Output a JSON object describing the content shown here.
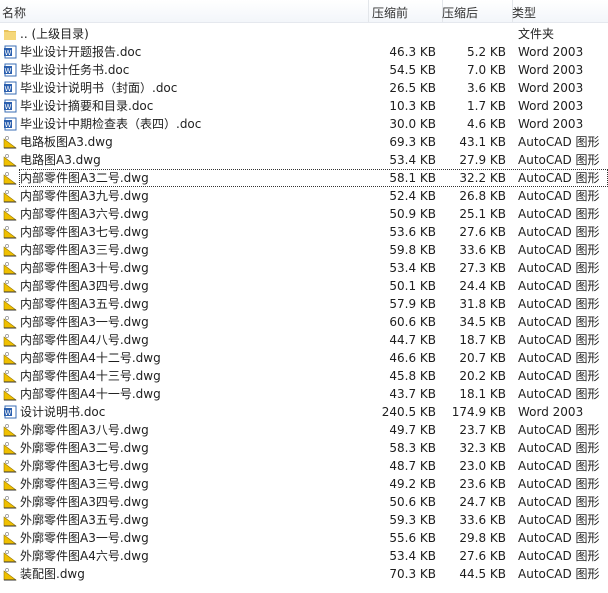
{
  "header": {
    "name": "名称",
    "size_before": "压缩前",
    "size_after": "压缩后",
    "type": "类型"
  },
  "focused_index": 8,
  "rows": [
    {
      "icon": "folder-icon",
      "name": ".. (上级目录)",
      "before": "",
      "after": "",
      "type": "文件夹"
    },
    {
      "icon": "word-icon",
      "name": "毕业设计开题报告.doc",
      "before": "46.3 KB",
      "after": "5.2 KB",
      "type": "Word 2003"
    },
    {
      "icon": "word-icon",
      "name": "毕业设计任务书.doc",
      "before": "54.5 KB",
      "after": "7.0 KB",
      "type": "Word 2003"
    },
    {
      "icon": "word-icon",
      "name": "毕业设计说明书（封面）.doc",
      "before": "26.5 KB",
      "after": "3.6 KB",
      "type": "Word 2003"
    },
    {
      "icon": "word-icon",
      "name": "毕业设计摘要和目录.doc",
      "before": "10.3 KB",
      "after": "1.7 KB",
      "type": "Word 2003"
    },
    {
      "icon": "word-icon",
      "name": "毕业设计中期检查表（表四）.doc",
      "before": "30.0 KB",
      "after": "4.6 KB",
      "type": "Word 2003"
    },
    {
      "icon": "autocad-icon",
      "name": "电路板图A3.dwg",
      "before": "69.3 KB",
      "after": "43.1 KB",
      "type": "AutoCAD 图形"
    },
    {
      "icon": "autocad-icon",
      "name": "电路图A3.dwg",
      "before": "53.4 KB",
      "after": "27.9 KB",
      "type": "AutoCAD 图形"
    },
    {
      "icon": "autocad-icon",
      "name": "内部零件图A3二号.dwg",
      "before": "58.1 KB",
      "after": "32.2 KB",
      "type": "AutoCAD 图形"
    },
    {
      "icon": "autocad-icon",
      "name": "内部零件图A3九号.dwg",
      "before": "52.4 KB",
      "after": "26.8 KB",
      "type": "AutoCAD 图形"
    },
    {
      "icon": "autocad-icon",
      "name": "内部零件图A3六号.dwg",
      "before": "50.9 KB",
      "after": "25.1 KB",
      "type": "AutoCAD 图形"
    },
    {
      "icon": "autocad-icon",
      "name": "内部零件图A3七号.dwg",
      "before": "53.6 KB",
      "after": "27.6 KB",
      "type": "AutoCAD 图形"
    },
    {
      "icon": "autocad-icon",
      "name": "内部零件图A3三号.dwg",
      "before": "59.8 KB",
      "after": "33.6 KB",
      "type": "AutoCAD 图形"
    },
    {
      "icon": "autocad-icon",
      "name": "内部零件图A3十号.dwg",
      "before": "53.4 KB",
      "after": "27.3 KB",
      "type": "AutoCAD 图形"
    },
    {
      "icon": "autocad-icon",
      "name": "内部零件图A3四号.dwg",
      "before": "50.1 KB",
      "after": "24.4 KB",
      "type": "AutoCAD 图形"
    },
    {
      "icon": "autocad-icon",
      "name": "内部零件图A3五号.dwg",
      "before": "57.9 KB",
      "after": "31.8 KB",
      "type": "AutoCAD 图形"
    },
    {
      "icon": "autocad-icon",
      "name": "内部零件图A3一号.dwg",
      "before": "60.6 KB",
      "after": "34.5 KB",
      "type": "AutoCAD 图形"
    },
    {
      "icon": "autocad-icon",
      "name": "内部零件图A4八号.dwg",
      "before": "44.7 KB",
      "after": "18.7 KB",
      "type": "AutoCAD 图形"
    },
    {
      "icon": "autocad-icon",
      "name": "内部零件图A4十二号.dwg",
      "before": "46.6 KB",
      "after": "20.7 KB",
      "type": "AutoCAD 图形"
    },
    {
      "icon": "autocad-icon",
      "name": "内部零件图A4十三号.dwg",
      "before": "45.8 KB",
      "after": "20.2 KB",
      "type": "AutoCAD 图形"
    },
    {
      "icon": "autocad-icon",
      "name": "内部零件图A4十一号.dwg",
      "before": "43.7 KB",
      "after": "18.1 KB",
      "type": "AutoCAD 图形"
    },
    {
      "icon": "word-icon",
      "name": "设计说明书.doc",
      "before": "240.5 KB",
      "after": "174.9 KB",
      "type": "Word 2003"
    },
    {
      "icon": "autocad-icon",
      "name": "外廓零件图A3八号.dwg",
      "before": "49.7 KB",
      "after": "23.7 KB",
      "type": "AutoCAD 图形"
    },
    {
      "icon": "autocad-icon",
      "name": "外廓零件图A3二号.dwg",
      "before": "58.3 KB",
      "after": "32.3 KB",
      "type": "AutoCAD 图形"
    },
    {
      "icon": "autocad-icon",
      "name": "外廓零件图A3七号.dwg",
      "before": "48.7 KB",
      "after": "23.0 KB",
      "type": "AutoCAD 图形"
    },
    {
      "icon": "autocad-icon",
      "name": "外廓零件图A3三号.dwg",
      "before": "49.2 KB",
      "after": "23.6 KB",
      "type": "AutoCAD 图形"
    },
    {
      "icon": "autocad-icon",
      "name": "外廓零件图A3四号.dwg",
      "before": "50.6 KB",
      "after": "24.7 KB",
      "type": "AutoCAD 图形"
    },
    {
      "icon": "autocad-icon",
      "name": "外廓零件图A3五号.dwg",
      "before": "59.3 KB",
      "after": "33.6 KB",
      "type": "AutoCAD 图形"
    },
    {
      "icon": "autocad-icon",
      "name": "外廓零件图A3一号.dwg",
      "before": "55.6 KB",
      "after": "29.8 KB",
      "type": "AutoCAD 图形"
    },
    {
      "icon": "autocad-icon",
      "name": "外廓零件图A4六号.dwg",
      "before": "53.4 KB",
      "after": "27.6 KB",
      "type": "AutoCAD 图形"
    },
    {
      "icon": "autocad-icon",
      "name": "装配图.dwg",
      "before": "70.3 KB",
      "after": "44.5 KB",
      "type": "AutoCAD 图形"
    }
  ]
}
